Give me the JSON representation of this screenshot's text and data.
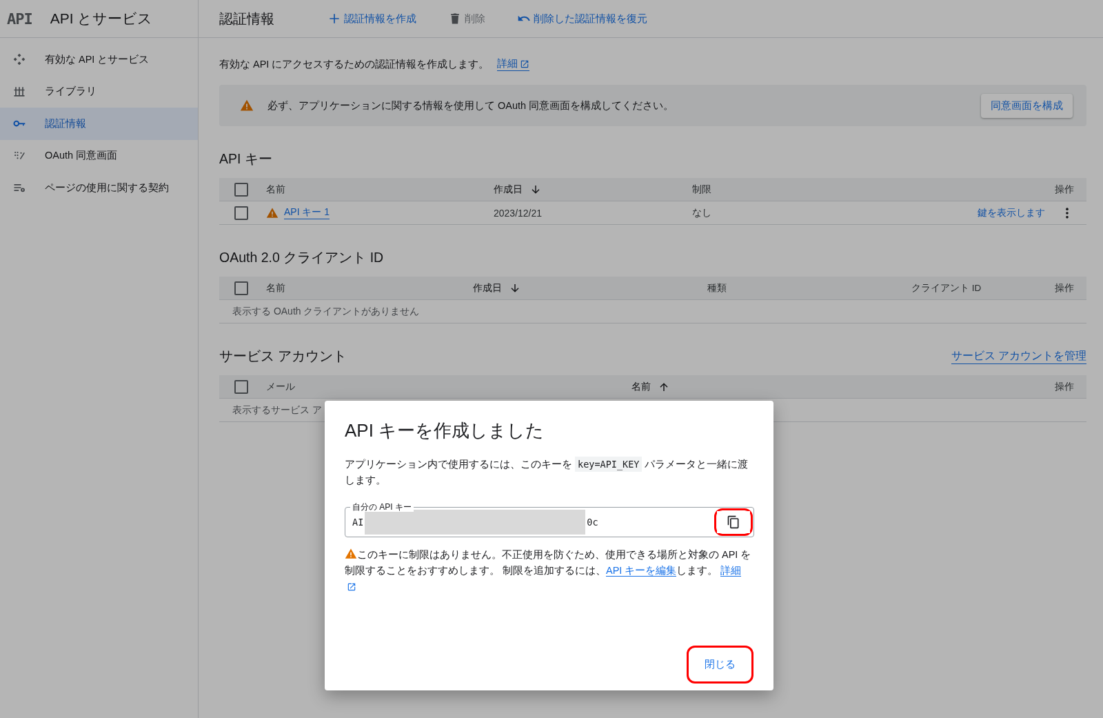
{
  "app": {
    "logo": "API",
    "title": "API とサービス"
  },
  "sidebar": {
    "items": [
      {
        "label": "有効な API とサービス",
        "selected": false
      },
      {
        "label": "ライブラリ",
        "selected": false
      },
      {
        "label": "認証情報",
        "selected": true
      },
      {
        "label": "OAuth 同意画面",
        "selected": false
      },
      {
        "label": "ページの使用に関する契約",
        "selected": false
      }
    ]
  },
  "toolbar": {
    "title": "認証情報",
    "actions": [
      {
        "label": "認証情報を作成",
        "disabled": false
      },
      {
        "label": "削除",
        "disabled": true
      },
      {
        "label": "削除した認証情報を復元",
        "disabled": false
      }
    ]
  },
  "intro": {
    "text": "有効な API にアクセスするための認証情報を作成します。",
    "link": "詳細"
  },
  "banner": {
    "text": "必ず、アプリケーションに関する情報を使用して OAuth 同意画面を構成してください。",
    "button": "同意画面を構成"
  },
  "sections": [
    {
      "title": "API キー",
      "select_all": false,
      "columns": [
        {
          "label": "名前",
          "sorted": false
        },
        {
          "label": "作成日",
          "sorted": true,
          "ascending": false
        },
        {
          "label": "制限",
          "sorted": false
        },
        {
          "label": "操作",
          "sorted": false
        }
      ],
      "rows": [
        {
          "checked": false,
          "warning": true,
          "name": "API キー 1",
          "created": "2023/12/21",
          "restriction": "なし",
          "action": "鍵を表示します"
        }
      ]
    },
    {
      "title": "OAuth 2.0 クライアント ID",
      "select_all": false,
      "columns": [
        {
          "label": "名前",
          "sorted": false
        },
        {
          "label": "作成日",
          "sorted": true,
          "ascending": false
        },
        {
          "label": "種類",
          "sorted": false
        },
        {
          "label": "クライアント ID",
          "sorted": false
        },
        {
          "label": "操作",
          "sorted": false
        }
      ],
      "empty": "表示する OAuth クライアントがありません"
    },
    {
      "title": "サービス アカウント",
      "link": "サービス アカウントを管理",
      "select_all": false,
      "columns": [
        {
          "label": "メール",
          "sorted": false
        },
        {
          "label": "名前",
          "sorted": true,
          "ascending": true
        },
        {
          "label": "操作",
          "sorted": false
        }
      ],
      "empty": "表示するサービス ア"
    }
  ],
  "dialog": {
    "title": "API キーを作成しました",
    "body": {
      "before": "アプリケーション内で使用するには、このキーを ",
      "code": "key=API_KEY",
      "after": " パラメータと一緒に渡します。"
    },
    "key_field": {
      "label": "自分の API キー",
      "value_start": "AI",
      "value_end": "0c",
      "redacted": true
    },
    "copy_highlighted": true,
    "warning": {
      "text": "このキーに制限はありません。不正使用を防ぐため、使用できる場所と対象の API を制限することをおすすめします。 制限を追加するには、",
      "link": "API キーを編集",
      "after": "します。 ",
      "more": "詳細"
    },
    "close": {
      "label": "閉じる",
      "highlighted": true
    }
  }
}
